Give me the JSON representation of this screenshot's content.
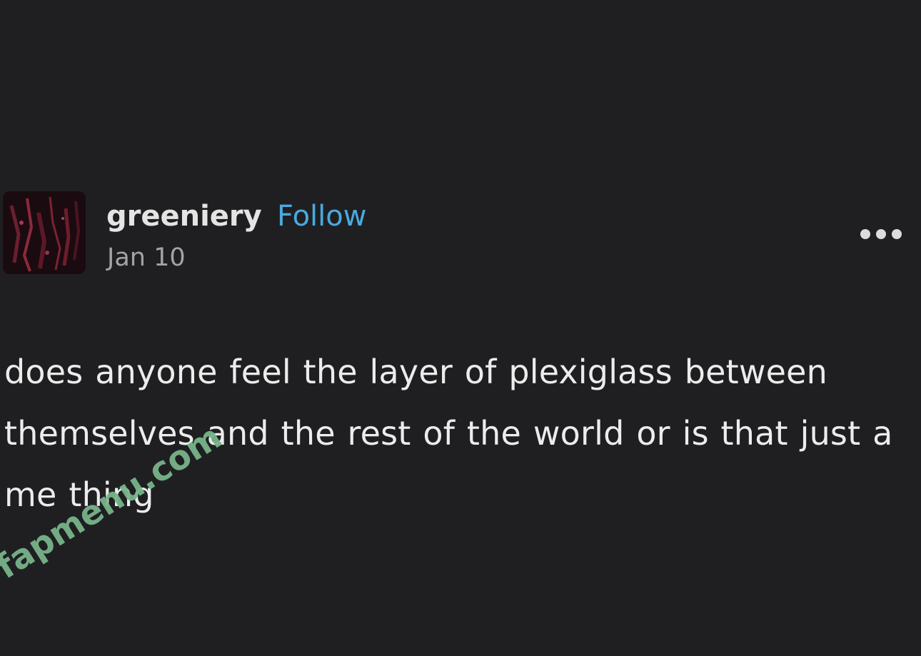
{
  "post": {
    "username": "greeniery",
    "follow_label": "Follow",
    "date": "Jan 10",
    "text": "does anyone feel the layer of plexiglass between themselves and the rest of the world or is that just a me thing"
  },
  "icons": {
    "avatar": "avatar-image",
    "more": "more-options-icon"
  },
  "watermark": {
    "text": "fapmenu.com"
  },
  "colors": {
    "background": "#1f1f21",
    "follow": "#4aa9e0",
    "watermark": "#78b48a"
  }
}
